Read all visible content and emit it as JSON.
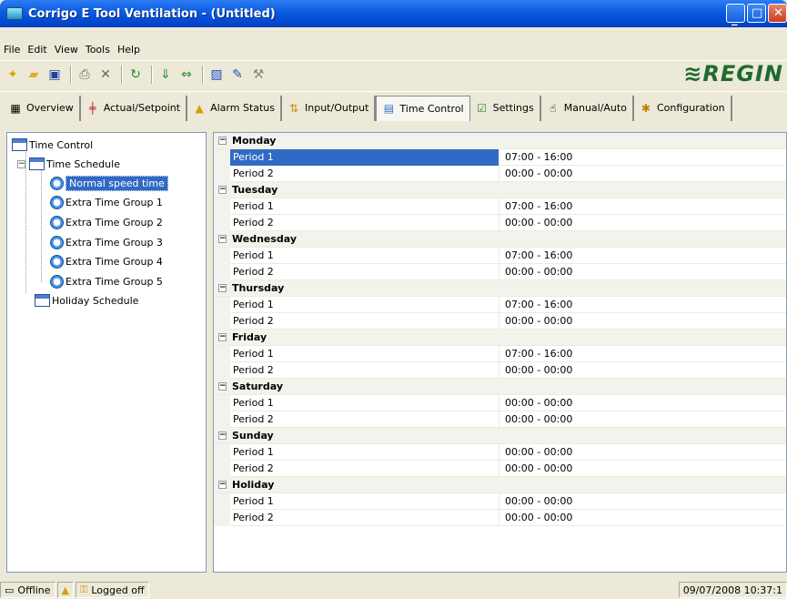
{
  "window": {
    "title": "Corrigo E Tool Ventilation - (Untitled)"
  },
  "menu": [
    "File",
    "Edit",
    "View",
    "Tools",
    "Help"
  ],
  "logo": "≋REGIN",
  "tabs": [
    {
      "label": "Overview",
      "icon": "overview-icon"
    },
    {
      "label": "Actual/Setpoint",
      "icon": "setpoint-icon"
    },
    {
      "label": "Alarm Status",
      "icon": "alarm-icon"
    },
    {
      "label": "Input/Output",
      "icon": "io-icon"
    },
    {
      "label": "Time Control",
      "icon": "calendar-icon",
      "active": true
    },
    {
      "label": "Settings",
      "icon": "settings-icon"
    },
    {
      "label": "Manual/Auto",
      "icon": "hand-icon"
    },
    {
      "label": "Configuration",
      "icon": "config-icon"
    }
  ],
  "tree": {
    "root": "Time Control",
    "schedule": "Time Schedule",
    "items": [
      "Normal speed time",
      "Extra Time Group 1",
      "Extra Time Group 2",
      "Extra Time Group 3",
      "Extra Time Group 4",
      "Extra Time Group 5"
    ],
    "holiday": "Holiday Schedule"
  },
  "schedule": [
    {
      "day": "Monday",
      "periods": [
        {
          "name": "Period 1",
          "value": "07:00 - 16:00"
        },
        {
          "name": "Period 2",
          "value": "00:00 - 00:00"
        }
      ]
    },
    {
      "day": "Tuesday",
      "periods": [
        {
          "name": "Period 1",
          "value": "07:00 - 16:00"
        },
        {
          "name": "Period 2",
          "value": "00:00 - 00:00"
        }
      ]
    },
    {
      "day": "Wednesday",
      "periods": [
        {
          "name": "Period 1",
          "value": "07:00 - 16:00"
        },
        {
          "name": "Period 2",
          "value": "00:00 - 00:00"
        }
      ]
    },
    {
      "day": "Thursday",
      "periods": [
        {
          "name": "Period 1",
          "value": "07:00 - 16:00"
        },
        {
          "name": "Period 2",
          "value": "00:00 - 00:00"
        }
      ]
    },
    {
      "day": "Friday",
      "periods": [
        {
          "name": "Period 1",
          "value": "07:00 - 16:00"
        },
        {
          "name": "Period 2",
          "value": "00:00 - 00:00"
        }
      ]
    },
    {
      "day": "Saturday",
      "periods": [
        {
          "name": "Period 1",
          "value": "00:00 - 00:00"
        },
        {
          "name": "Period 2",
          "value": "00:00 - 00:00"
        }
      ]
    },
    {
      "day": "Sunday",
      "periods": [
        {
          "name": "Period 1",
          "value": "00:00 - 00:00"
        },
        {
          "name": "Period 2",
          "value": "00:00 - 00:00"
        }
      ]
    },
    {
      "day": "Holiday",
      "periods": [
        {
          "name": "Period 1",
          "value": "00:00 - 00:00"
        },
        {
          "name": "Period 2",
          "value": "00:00 - 00:00"
        }
      ]
    }
  ],
  "status": {
    "connection": "Offline",
    "login": "Logged off",
    "datetime": "09/07/2008 10:37:1"
  }
}
